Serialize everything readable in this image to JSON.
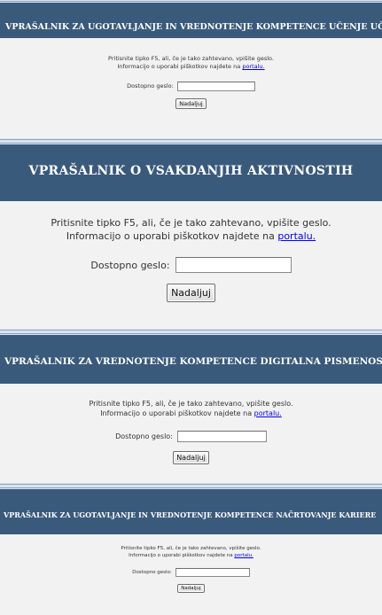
{
  "colors": {
    "header_bg": "#3a5a7c",
    "header_text": "#ffffff",
    "panel_bg": "#f2f2f2",
    "link": "#0000ee",
    "separator": "#d9e3ee"
  },
  "panels": [
    {
      "title": "VPRAŠALNIK ZA UGOTAVLJANJE IN VREDNOTENJE KOMPETENCE UČENJE UČENJA",
      "instruction": "Pritisnite tipko F5, ali, če je tako zahtevano, vpišite geslo.",
      "info_text": "Informacijo o uporabi piškotkov najdete na",
      "link_text": "portalu.",
      "field_label": "Dostopno geslo:",
      "field_value": "",
      "button_label": "Nadaljuj"
    },
    {
      "title": "VPRAŠALNIK O VSAKDANJIH AKTIVNOSTIH",
      "instruction": "Pritisnite tipko F5, ali, če je tako zahtevano, vpišite geslo.",
      "info_text": "Informacijo o uporabi piškotkov najdete na",
      "link_text": "portalu.",
      "field_label": "Dostopno geslo:",
      "field_value": "",
      "button_label": "Nadaljuj"
    },
    {
      "title": "VPRAŠALNIK ZA VREDNOTENJE KOMPETENCE DIGITALNA PISMENOST",
      "instruction": "Pritisnite tipko F5, ali, če je tako zahtevano, vpišite geslo.",
      "info_text": "Informacijo o uporabi piškotkov najdete na",
      "link_text": "portalu.",
      "field_label": "Dostopno geslo:",
      "field_value": "",
      "button_label": "Nadaljuj"
    },
    {
      "title": "VPRAŠALNIK ZA UGOTAVLJANJE IN VREDNOTENJE KOMPETENCE NAČRTOVANJE KARIERE",
      "instruction": "Pritisnite tipko F5, ali, če je tako zahtevano, vpišite geslo.",
      "info_text": "Informacijo o uporabi piškotkov najdete na",
      "link_text": "portalu.",
      "field_label": "Dostopno geslo:",
      "field_value": "",
      "button_label": "Nadaljuj"
    }
  ]
}
